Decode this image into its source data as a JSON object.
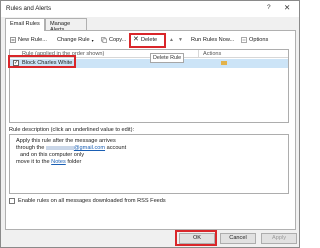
{
  "window": {
    "title": "Rules and Alerts",
    "help": "?",
    "close": "✕"
  },
  "tabs": [
    {
      "label": "Email Rules"
    },
    {
      "label": "Manage Alerts"
    }
  ],
  "toolbar": {
    "new_rule": "New Rule...",
    "change_rule": "Change Rule",
    "copy": "Copy...",
    "delete": "Delete",
    "run_rules": "Run Rules Now...",
    "options": "Options"
  },
  "tooltip": "Delete Rule",
  "rules_list": {
    "col_rule": "Rule (applied in the order shown)",
    "col_actions": "Actions",
    "rows": [
      {
        "name": "Block Charles White",
        "checked": true
      }
    ]
  },
  "description": {
    "label": "Rule description (click an underlined value to edit):",
    "line1": "Apply this rule after the message arrives",
    "line2_prefix": "through the",
    "line2_link": "@gmail.com",
    "line2_suffix": "account",
    "line3": "and on this computer only",
    "line4_prefix": "move it to the",
    "line4_link": "Notes",
    "line4_suffix": "folder"
  },
  "rss_label": "Enable rules on all messages downloaded from RSS Feeds",
  "buttons": {
    "ok": "OK",
    "cancel": "Cancel",
    "apply": "Apply"
  },
  "colors": {
    "highlight": "#d9262a",
    "selection": "#cce4f7",
    "link": "#1a5fb4"
  }
}
